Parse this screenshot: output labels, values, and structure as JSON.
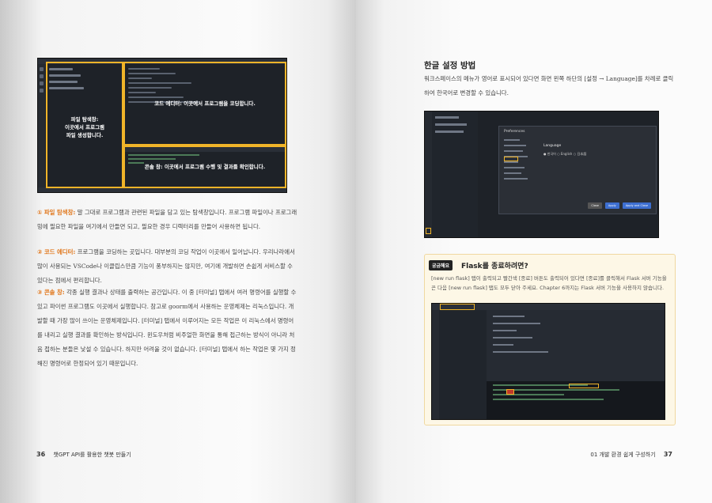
{
  "left_page": {
    "figure": {
      "explorer_label_1": "파일 탐색창:",
      "explorer_label_2": "이곳에서 프로그램",
      "explorer_label_3": "파일 생성합니다.",
      "editor_label": "코드 에디터: 이곳에서 프로그램을 코딩합니다.",
      "console_label": "콘솔 창: 이곳에서 프로그램 수행 및 결과를 확인합니다."
    },
    "items": [
      {
        "tag": "① 파일 탐색창:",
        "text": "말 그대로 프로그램과 관련된 파일을 담고 있는 탐색창입니다. 프로그램 파일이나 프로그래밍에 필요한 파일을 여기에서 만들면 되고, 필요한 경우 디렉터리를 만들어 사용하면 됩니다."
      },
      {
        "tag": "② 코드 에디터:",
        "text": "프로그램을 코딩하는 곳입니다. 대부분의 코딩 작업이 이곳에서 일어납니다. 우리나라에서 많이 사용되는 VSCode나 이클립스만큼 기능이 풍부하지는 않지만, 여기에 개발하면 손쉽게 서비스할 수 있다는 점에서 편리합니다."
      },
      {
        "tag": "③ 콘솔 창:",
        "text": "각종 실행 결과나 상태를 출력하는 공간입니다. 이 중 [터미널] 탭에서 여러 명령어를 실행할 수 있고 파이썬 프로그램도 이곳에서 실행합니다. 참고로 goorm에서 사용하는 운영체제는 리눅스입니다. 개발할 때 가장 많이 쓰이는 운영체제입니다. [터미널] 탭에서 이루어지는 모든 작업은 이 리눅스에서 명령어를 내리고 실행 결과를 확인하는 방식입니다. 윈도우처럼 비주얼한 화면을 통해 접근하는 방식이 아니라 처음 접하는 분들은 낯설 수 있습니다. 하지만 어려울 것이 없습니다. [터미널] 탭에서 하는 작업은 몇 가지 정해진 명령어로 한정되어 있기 때문입니다."
      }
    ],
    "footer": {
      "page_number": "36",
      "book_title": "챗GPT API를 활용한 챗봇 만들기"
    }
  },
  "right_page": {
    "heading": "한글 설정 방법",
    "paragraph": "워크스페이스의 메뉴가 영어로 표시되어 있다면 화면 왼쪽 하단의 [설정 → Language]를 차례로 클릭하여 한국어로 변경할 수 있습니다.",
    "dialog": {
      "title": "Preferences",
      "language_label": "Language",
      "options": [
        "한국어",
        "English",
        "日本語"
      ],
      "buttons": [
        "Close",
        "Apply",
        "Apply and Close"
      ]
    },
    "tip": {
      "badge": "궁금해요",
      "title": "Flask를 종료하려면?",
      "text": "[new run flask] 탭이 출력되고 빨간색 [종료] 버튼도 출력되어 있다면 [종료]를 클릭해서 Flask 서버 기능을 끈 다음 [new run flask] 탭도 모두 닫아 주세요. Chapter 6까지는 Flask 서버 기능을 사용하지 않습니다."
    },
    "footer": {
      "chapter": "01 개발 환경 쉽게 구성하기",
      "page_number": "37"
    }
  },
  "colors": {
    "highlight": "#f0b429",
    "tag_orange": "#e0761a",
    "ide_bg": "#1e2228",
    "tip_bg": "#fdf7e6"
  }
}
